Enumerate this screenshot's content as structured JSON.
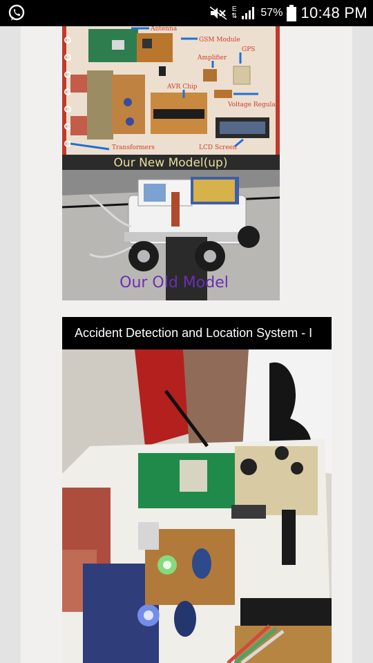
{
  "status_bar": {
    "battery_percent": "57%",
    "time": "10:48 PM",
    "network_type": "E",
    "icons": [
      "whatsapp-icon",
      "mute-icon",
      "data-arrows-icon",
      "signal-icon",
      "battery-icon"
    ]
  },
  "image1": {
    "labels": {
      "antenna": "Antenna",
      "gsm_module": "GSM Module",
      "amplifier": "Amplifier",
      "gps": "GPS",
      "avr_chip": "AVR Chip",
      "voltage_regulator": "Voltage Regulator",
      "transformers": "Transformers",
      "lcd_screen": "LCD Screen"
    },
    "caption_top": "Our New Model(up)",
    "caption_bottom": "Our Old Model"
  },
  "video": {
    "title": "Accident Detection and Location System - I"
  },
  "colors": {
    "caption_top": "#e8df9a",
    "caption_bottom": "#6a2fb5",
    "label_red": "#d23b2b",
    "arrow_blue": "#1f6fd6"
  }
}
